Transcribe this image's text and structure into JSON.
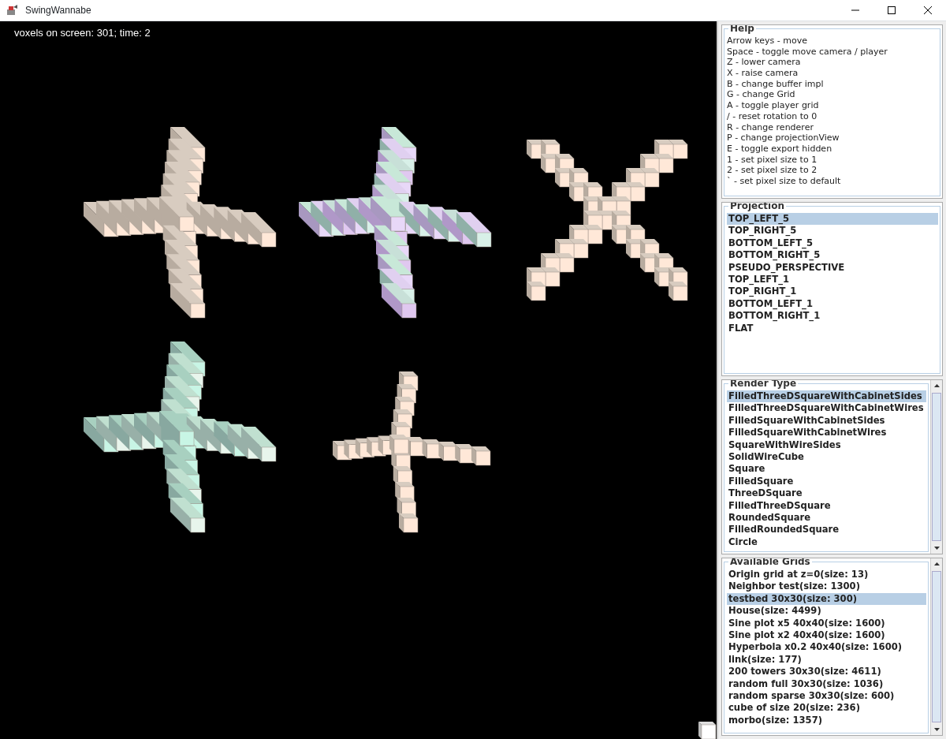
{
  "window": {
    "title": "SwingWannabe"
  },
  "canvas": {
    "status": "voxels on screen: 301; time: 2"
  },
  "help": {
    "title": "Help",
    "lines": [
      "Arrow keys - move",
      "Space - toggle move camera / player",
      "Z - lower camera",
      "X - raise camera",
      "B - change buffer impl",
      "G - change Grid",
      "A - toggle player grid",
      "/ - reset rotation to 0",
      "R - change renderer",
      "P - change projectionView",
      "E - toggle export hidden",
      "1 - set pixel size to 1",
      "2 - set pixel size to 2",
      "` - set pixel size to default"
    ]
  },
  "projection": {
    "title": "Projection",
    "items": [
      {
        "label": "TOP_LEFT_5",
        "selected": true
      },
      {
        "label": "TOP_RIGHT_5",
        "selected": false
      },
      {
        "label": "BOTTOM_LEFT_5",
        "selected": false
      },
      {
        "label": "BOTTOM_RIGHT_5",
        "selected": false
      },
      {
        "label": "PSEUDO_PERSPECTIVE",
        "selected": false
      },
      {
        "label": "TOP_LEFT_1",
        "selected": false
      },
      {
        "label": "TOP_RIGHT_1",
        "selected": false
      },
      {
        "label": "BOTTOM_LEFT_1",
        "selected": false
      },
      {
        "label": "BOTTOM_RIGHT_1",
        "selected": false
      },
      {
        "label": "FLAT",
        "selected": false
      }
    ]
  },
  "render_type": {
    "title": "Render Type",
    "items": [
      {
        "label": "FilledThreeDSquareWithCabinetSides",
        "selected": true
      },
      {
        "label": "FilledThreeDSquareWithCabinetWires",
        "selected": false
      },
      {
        "label": "FilledSquareWithCabinetSides",
        "selected": false
      },
      {
        "label": "FilledSquareWithCabinetWires",
        "selected": false
      },
      {
        "label": "SquareWithWireSides",
        "selected": false
      },
      {
        "label": "SolidWireCube",
        "selected": false
      },
      {
        "label": "Square",
        "selected": false
      },
      {
        "label": "FilledSquare",
        "selected": false
      },
      {
        "label": "ThreeDSquare",
        "selected": false
      },
      {
        "label": "FilledThreeDSquare",
        "selected": false
      },
      {
        "label": "RoundedSquare",
        "selected": false
      },
      {
        "label": "FilledRoundedSquare",
        "selected": false
      },
      {
        "label": "Circle",
        "selected": false
      }
    ]
  },
  "grids": {
    "title": "Available Grids",
    "items": [
      {
        "label": "Origin grid at z=0(size: 13)",
        "selected": false
      },
      {
        "label": "Neighbor test(size: 1300)",
        "selected": false
      },
      {
        "label": "testbed 30x30(size: 300)",
        "selected": true
      },
      {
        "label": "House(size: 4499)",
        "selected": false
      },
      {
        "label": "Sine plot x5 40x40(size: 1600)",
        "selected": false
      },
      {
        "label": "Sine plot x2 40x40(size: 1600)",
        "selected": false
      },
      {
        "label": "Hyperbola x0.2 40x40(size: 1600)",
        "selected": false
      },
      {
        "label": "link(size: 177)",
        "selected": false
      },
      {
        "label": "200 towers 30x30(size: 4611)",
        "selected": false
      },
      {
        "label": "random full 30x30(size: 1036)",
        "selected": false
      },
      {
        "label": "random sparse 30x30(size: 600)",
        "selected": false
      },
      {
        "label": "cube of size 20(size: 236)",
        "selected": false
      },
      {
        "label": "morbo(size: 1357)",
        "selected": false
      }
    ]
  }
}
